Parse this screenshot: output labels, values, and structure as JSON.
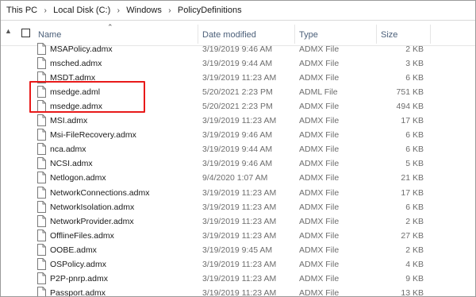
{
  "breadcrumb": [
    "This PC",
    "Local Disk (C:)",
    "Windows",
    "PolicyDefinitions"
  ],
  "columns": {
    "name": "Name",
    "date": "Date modified",
    "type": "Type",
    "size": "Size"
  },
  "files": [
    {
      "name": "MSAPolicy.admx",
      "date": "3/19/2019 9:46 AM",
      "type": "ADMX File",
      "size": "2 KB"
    },
    {
      "name": "msched.admx",
      "date": "3/19/2019 9:44 AM",
      "type": "ADMX File",
      "size": "3 KB"
    },
    {
      "name": "MSDT.admx",
      "date": "3/19/2019 11:23 AM",
      "type": "ADMX File",
      "size": "6 KB"
    },
    {
      "name": "msedge.adml",
      "date": "5/20/2021 2:23 PM",
      "type": "ADML File",
      "size": "751 KB"
    },
    {
      "name": "msedge.admx",
      "date": "5/20/2021 2:23 PM",
      "type": "ADMX File",
      "size": "494 KB"
    },
    {
      "name": "MSI.admx",
      "date": "3/19/2019 11:23 AM",
      "type": "ADMX File",
      "size": "17 KB"
    },
    {
      "name": "Msi-FileRecovery.admx",
      "date": "3/19/2019 9:46 AM",
      "type": "ADMX File",
      "size": "6 KB"
    },
    {
      "name": "nca.admx",
      "date": "3/19/2019 9:44 AM",
      "type": "ADMX File",
      "size": "6 KB"
    },
    {
      "name": "NCSI.admx",
      "date": "3/19/2019 9:46 AM",
      "type": "ADMX File",
      "size": "5 KB"
    },
    {
      "name": "Netlogon.admx",
      "date": "9/4/2020 1:07 AM",
      "type": "ADMX File",
      "size": "21 KB"
    },
    {
      "name": "NetworkConnections.admx",
      "date": "3/19/2019 11:23 AM",
      "type": "ADMX File",
      "size": "17 KB"
    },
    {
      "name": "NetworkIsolation.admx",
      "date": "3/19/2019 11:23 AM",
      "type": "ADMX File",
      "size": "6 KB"
    },
    {
      "name": "NetworkProvider.admx",
      "date": "3/19/2019 11:23 AM",
      "type": "ADMX File",
      "size": "2 KB"
    },
    {
      "name": "OfflineFiles.admx",
      "date": "3/19/2019 11:23 AM",
      "type": "ADMX File",
      "size": "27 KB"
    },
    {
      "name": "OOBE.admx",
      "date": "3/19/2019 9:45 AM",
      "type": "ADMX File",
      "size": "2 KB"
    },
    {
      "name": "OSPolicy.admx",
      "date": "3/19/2019 11:23 AM",
      "type": "ADMX File",
      "size": "4 KB"
    },
    {
      "name": "P2P-pnrp.admx",
      "date": "3/19/2019 11:23 AM",
      "type": "ADMX File",
      "size": "9 KB"
    },
    {
      "name": "Passport.admx",
      "date": "3/19/2019 11:23 AM",
      "type": "ADMX File",
      "size": "13 KB"
    }
  ],
  "highlighted_files": [
    "msedge.adml",
    "msedge.admx"
  ],
  "colors": {
    "highlight": "#e81a1a",
    "header_text": "#4c607a",
    "muted_text": "#6d6d6d"
  },
  "icons": {
    "file": "document-icon",
    "sort": "sort-ascending-icon",
    "scroll_up": "chevron-up-icon",
    "separator": "chevron-right-icon"
  }
}
